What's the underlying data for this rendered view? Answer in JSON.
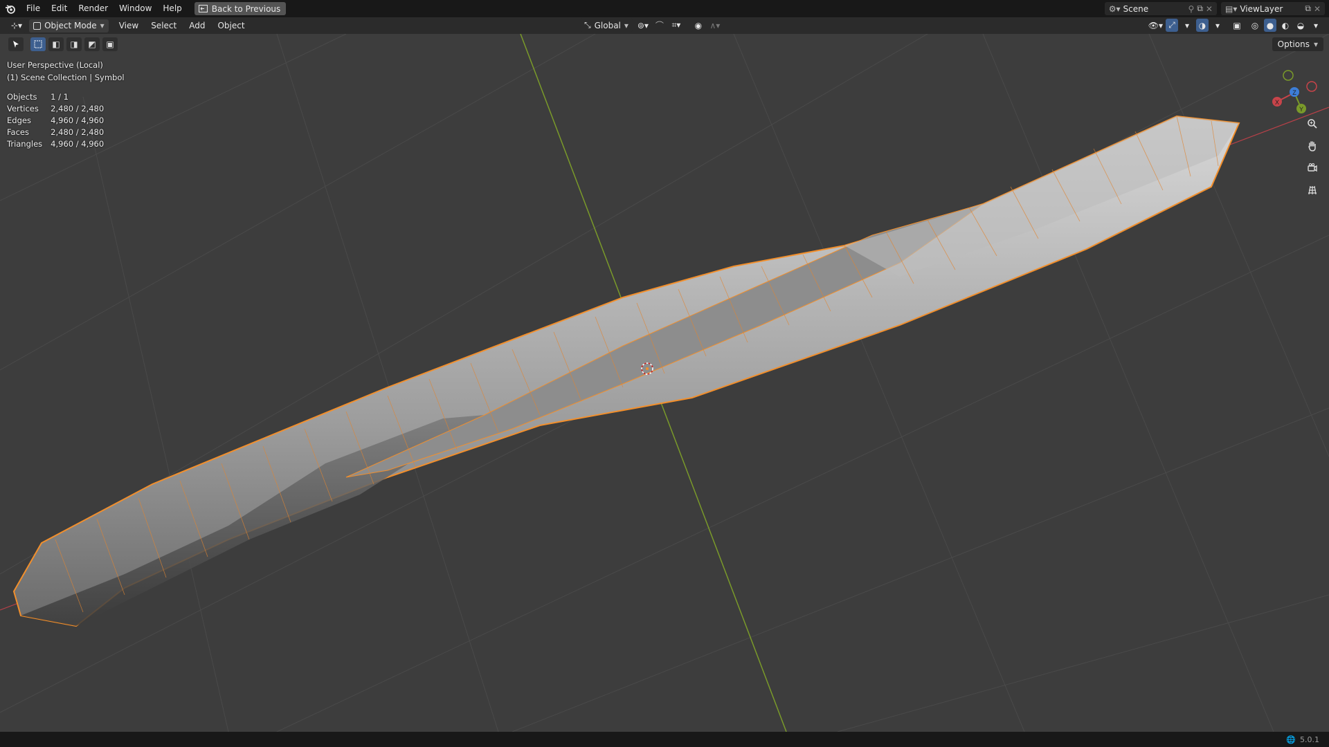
{
  "topbar": {
    "menus": [
      "File",
      "Edit",
      "Render",
      "Window",
      "Help"
    ],
    "back_button": "Back to Previous",
    "scene_name": "Scene",
    "view_layer": "ViewLayer"
  },
  "header": {
    "mode": "Object Mode",
    "menus": [
      "View",
      "Select",
      "Add",
      "Object"
    ],
    "transform_orientation": "Global",
    "options_label": "Options"
  },
  "viewport": {
    "perspective": "User Perspective (Local)",
    "collection": "(1) Scene Collection | Symbol",
    "stats": [
      {
        "label": "Objects",
        "value": "1 / 1"
      },
      {
        "label": "Vertices",
        "value": "2,480 / 2,480"
      },
      {
        "label": "Edges",
        "value": "4,960 / 4,960"
      },
      {
        "label": "Faces",
        "value": "2,480 / 2,480"
      },
      {
        "label": "Triangles",
        "value": "4,960 / 4,960"
      }
    ],
    "gizmo_axes": [
      "X",
      "Y",
      "Z"
    ]
  },
  "statusbar": {
    "version": "5.0.1"
  },
  "colors": {
    "selection_outline": "#f28f2c",
    "x_axis": "#c8444a",
    "y_axis": "#7a9a2a",
    "z_axis": "#3d7ed8"
  },
  "icons": [
    "blender-logo-icon",
    "zoom-icon",
    "hand-pan-icon",
    "camera-icon",
    "grid-ortho-icon"
  ]
}
